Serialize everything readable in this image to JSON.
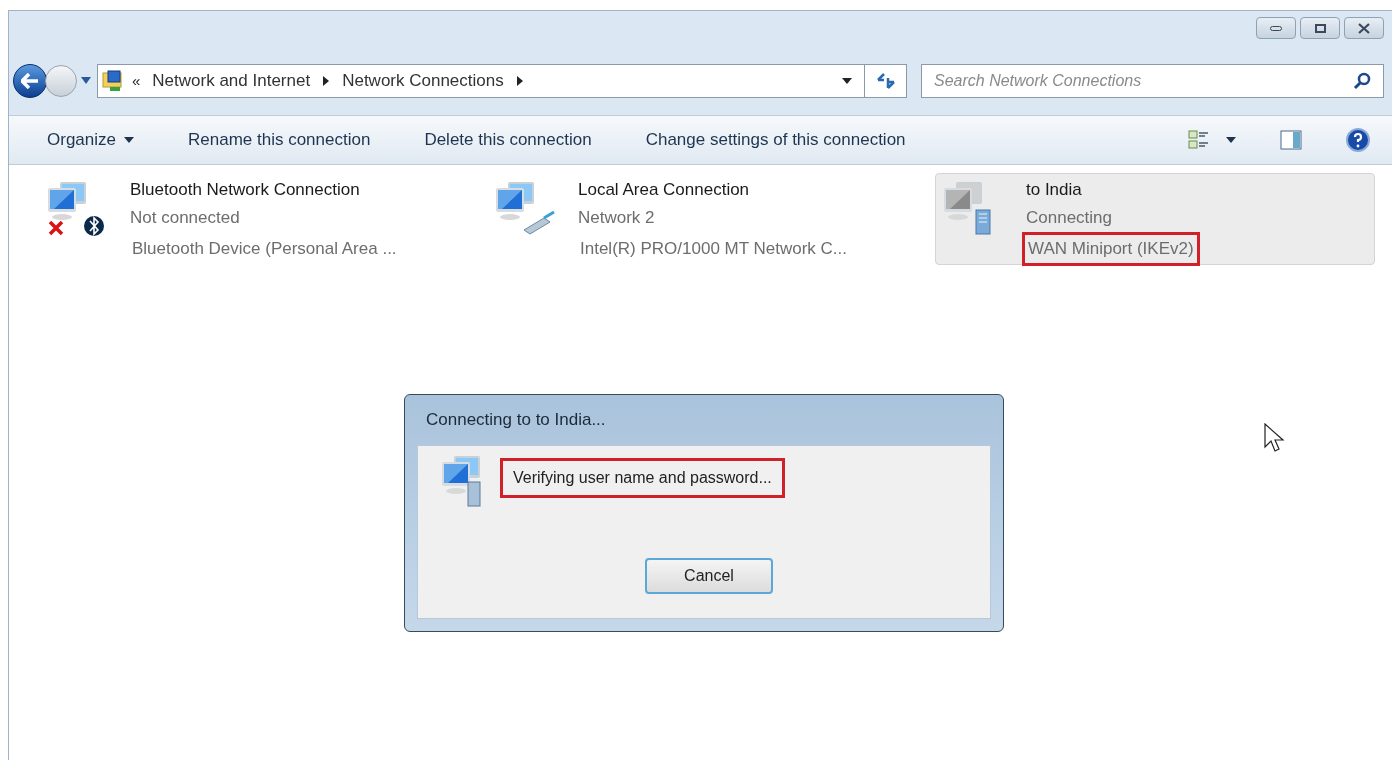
{
  "window": {
    "buttons": [
      {
        "kind": "minimize"
      },
      {
        "kind": "maximize"
      },
      {
        "kind": "close"
      }
    ]
  },
  "address_bar": {
    "overflow": "«",
    "crumbs": [
      "Network and Internet",
      "Network Connections"
    ]
  },
  "search": {
    "placeholder": "Search Network Connections"
  },
  "toolbar": {
    "items": [
      {
        "label": "Organize",
        "dropdown": true
      },
      {
        "label": "Rename this connection",
        "dropdown": false
      },
      {
        "label": "Delete this connection",
        "dropdown": false
      },
      {
        "label": "Change settings of this connection",
        "dropdown": false
      }
    ]
  },
  "connections": [
    {
      "kind": "bluetooth",
      "name": "Bluetooth Network Connection",
      "status": "Not connected",
      "device": "Bluetooth Device (Personal Area ...",
      "selected": false,
      "highlighted": false,
      "disconnected": true
    },
    {
      "kind": "ethernet",
      "name": "Local Area Connection",
      "status": "Network  2",
      "device": "Intel(R) PRO/1000 MT Network C...",
      "selected": false,
      "highlighted": false,
      "disconnected": false
    },
    {
      "kind": "vpn",
      "name": "to India",
      "status": "Connecting",
      "device": "WAN Miniport (IKEv2)",
      "selected": true,
      "highlighted": true,
      "disconnected": false
    }
  ],
  "dialog": {
    "title": "Connecting to to India...",
    "message": "Verifying user name and password...",
    "highlighted": true,
    "button": "Cancel"
  }
}
